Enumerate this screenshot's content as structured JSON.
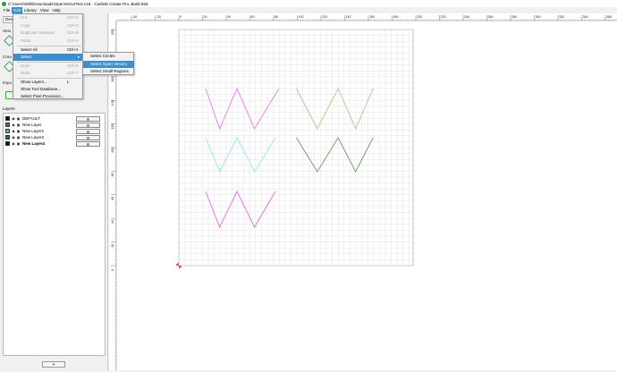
{
  "window": {
    "title": "C:\\Users\\Willi\\Downloads\\OpenVectorTest.c2d - Carbide Create Pro, Build 655"
  },
  "menubar": [
    {
      "label": "File",
      "active": false
    },
    {
      "label": "Edit",
      "active": true
    },
    {
      "label": "Library",
      "active": false
    },
    {
      "label": "View",
      "active": false
    },
    {
      "label": "Help",
      "active": false
    }
  ],
  "left_panel": {
    "tab_design": "Des",
    "setup_label": "Setu",
    "create_label": "Crea",
    "import_label": "Impo",
    "layers_title": "Layers",
    "layers": [
      {
        "name": "DEFAULT",
        "color": "#111111",
        "bold": false
      },
      {
        "name": "New Layer",
        "color": "#7a6a1e",
        "bold": false
      },
      {
        "name": "New Layer2",
        "color": "#2ad0df",
        "bold": false
      },
      {
        "name": "New Layer3",
        "color": "#1f7a26",
        "bold": false
      },
      {
        "name": "New Layer4",
        "color": "#111111",
        "bold": true
      }
    ],
    "add_label": "+"
  },
  "edit_menu": {
    "items": [
      {
        "label": "Cut",
        "shortcut": "Ctrl+X",
        "disabled": true
      },
      {
        "label": "Copy",
        "shortcut": "Ctrl+C",
        "disabled": true
      },
      {
        "label": "Duplicate Selected",
        "shortcut": "Ctrl+D",
        "disabled": true
      },
      {
        "label": "Paste",
        "shortcut": "Ctrl+V",
        "disabled": true
      },
      {
        "label": "Select All",
        "shortcut": "Ctrl+A",
        "disabled": false
      },
      {
        "label": "Select",
        "shortcut": "",
        "disabled": false,
        "highlight": true,
        "submenu": true
      },
      {
        "label": "Undo",
        "shortcut": "Ctrl+Z",
        "disabled": true
      },
      {
        "label": "Redo",
        "shortcut": "Ctrl+Y",
        "disabled": true
      },
      {
        "label": "Show Layers...",
        "shortcut": "L",
        "disabled": false
      },
      {
        "label": "Show Tool Database...",
        "shortcut": "",
        "disabled": false
      },
      {
        "label": "Select Pixel Processor...",
        "shortcut": "",
        "disabled": false
      }
    ]
  },
  "select_submenu": [
    {
      "label": "Select Circles",
      "highlight": false
    },
    {
      "label": "Select Open Vectors",
      "highlight": true
    },
    {
      "label": "Select Small Regions",
      "highlight": false
    }
  ],
  "ruler": {
    "x_ticks": [
      "-40",
      "-20",
      "0",
      "20",
      "40",
      "60",
      "80",
      "100",
      "120",
      "140",
      "160",
      "180",
      "200",
      "220",
      "240",
      "260",
      "280",
      "300",
      "320",
      "340",
      "360"
    ],
    "y_ticks": [
      "200",
      "180",
      "160",
      "140",
      "120",
      "100",
      "80",
      "60",
      "40",
      "20",
      "0"
    ]
  },
  "vectors": [
    {
      "id": "pink-upper",
      "color": "#e27ee2",
      "points": [
        [
          0,
          70
        ],
        [
          20,
          115
        ],
        [
          45,
          70
        ],
        [
          70,
          115
        ],
        [
          105,
          70
        ]
      ]
    },
    {
      "id": "olive",
      "color": "#b4c48a",
      "points": [
        [
          130,
          70
        ],
        [
          160,
          115
        ],
        [
          190,
          70
        ],
        [
          215,
          115
        ],
        [
          240,
          70
        ]
      ]
    },
    {
      "id": "cyan",
      "color": "#8fe8ec",
      "points": [
        [
          0,
          125
        ],
        [
          20,
          163
        ],
        [
          45,
          125
        ],
        [
          70,
          163
        ],
        [
          100,
          125
        ]
      ]
    },
    {
      "id": "green",
      "color": "#6a9a5e",
      "points": [
        [
          130,
          125
        ],
        [
          160,
          163
        ],
        [
          190,
          125
        ],
        [
          215,
          163
        ],
        [
          240,
          125
        ]
      ]
    },
    {
      "id": "magenta-lower",
      "color": "#e06cdf",
      "points": [
        [
          0,
          185
        ],
        [
          20,
          225
        ],
        [
          45,
          185
        ],
        [
          70,
          225
        ],
        [
          100,
          185
        ]
      ]
    }
  ]
}
